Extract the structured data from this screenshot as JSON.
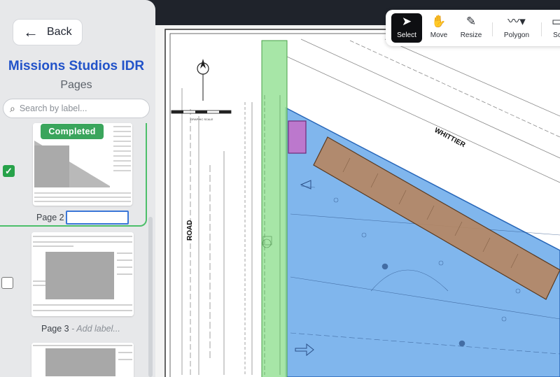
{
  "sidebar": {
    "back_label": "Back",
    "project_title": "Missions Studios IDR",
    "pages_heading": "Pages",
    "search_placeholder": "Search by label...",
    "pages": [
      {
        "label": "Page 2",
        "status": "Completed",
        "checked": true,
        "label_value": ""
      },
      {
        "label": "Page 3",
        "label_hint": "- Add label...",
        "checked": false
      }
    ]
  },
  "toolbar": {
    "tools": [
      {
        "label": "Select",
        "icon": "cursor-arrow-icon",
        "active": true
      },
      {
        "label": "Move",
        "icon": "hand-icon",
        "active": false
      },
      {
        "label": "Resize",
        "icon": "pencil-icon",
        "active": false
      },
      {
        "label": "Polygon",
        "icon": "polyline-icon",
        "active": false
      },
      {
        "label": "Sc",
        "icon": "scale-icon",
        "active": false
      }
    ]
  },
  "drawing": {
    "street_label_1": "WHITTIER",
    "street_label_2": "ROAD",
    "scale_caption": "GRAPHIC SCALE",
    "colors": {
      "green_zone": "#9be39b",
      "blue_zone": "#6aa9ea",
      "brown_zone": "#b58763",
      "purple_zone": "#c271c9"
    }
  }
}
